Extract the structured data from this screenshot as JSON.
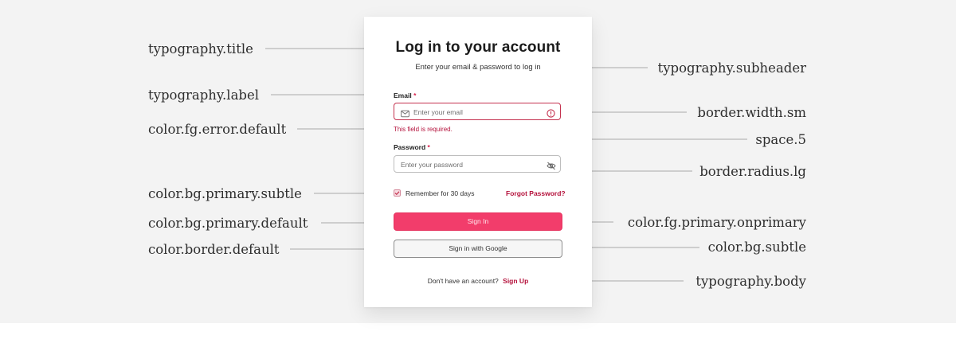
{
  "login_card": {
    "title": "Log in to your account",
    "subheader": "Enter your email & password to log in",
    "email_label": "Email",
    "password_label": "Password",
    "required_mark": "*",
    "email_placeholder": "Enter your email",
    "password_placeholder": "Enter your password",
    "email_error": "This field is required.",
    "remember_label": "Remember for 30 days",
    "forgot_password": "Forgot Password?",
    "sign_in": "Sign In",
    "sign_in_google": "Sign in with Google",
    "no_account": "Don't have an account?",
    "sign_up": "Sign Up"
  },
  "annotations": {
    "left": [
      "typography.title",
      "typography.label",
      "color.fg.error.default",
      "color.bg.primary.subtle",
      "color.bg.primary.default",
      "color.border.default"
    ],
    "right": [
      "typography.subheader",
      "border.width.sm",
      "space.5",
      "border.radius.lg",
      "color.fg.primary.onprimary",
      "color.bg.subtle",
      "typography.body"
    ]
  },
  "colors": {
    "primary": "#f23d6b",
    "error": "#b5123c",
    "border_default": "#8d8d8d",
    "bg_subtle": "#f6f6f6",
    "canvas": "#f3f3f3"
  },
  "icons": {
    "email_field": "envelope-icon",
    "error_indicator": "alert-circle-icon",
    "password_toggle": "eye-off-icon",
    "remember_checkbox": "checkbox-icon"
  }
}
